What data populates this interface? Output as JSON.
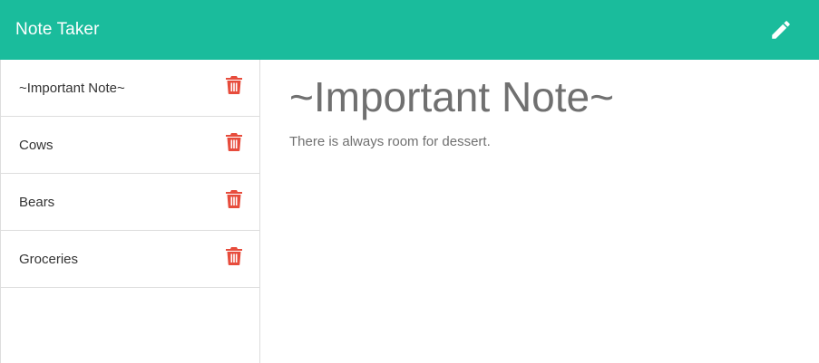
{
  "app": {
    "title": "Note Taker"
  },
  "colors": {
    "navbar": "#1abc9c",
    "trash": "#e74c3c"
  },
  "icons": {
    "new_note": "pencil-icon",
    "delete": "trash-icon"
  },
  "sidebar": {
    "notes": [
      {
        "title": "~Important Note~"
      },
      {
        "title": "Cows"
      },
      {
        "title": "Bears"
      },
      {
        "title": "Groceries"
      }
    ]
  },
  "main": {
    "note_title": "~Important Note~",
    "note_text": "There is always room for dessert."
  }
}
